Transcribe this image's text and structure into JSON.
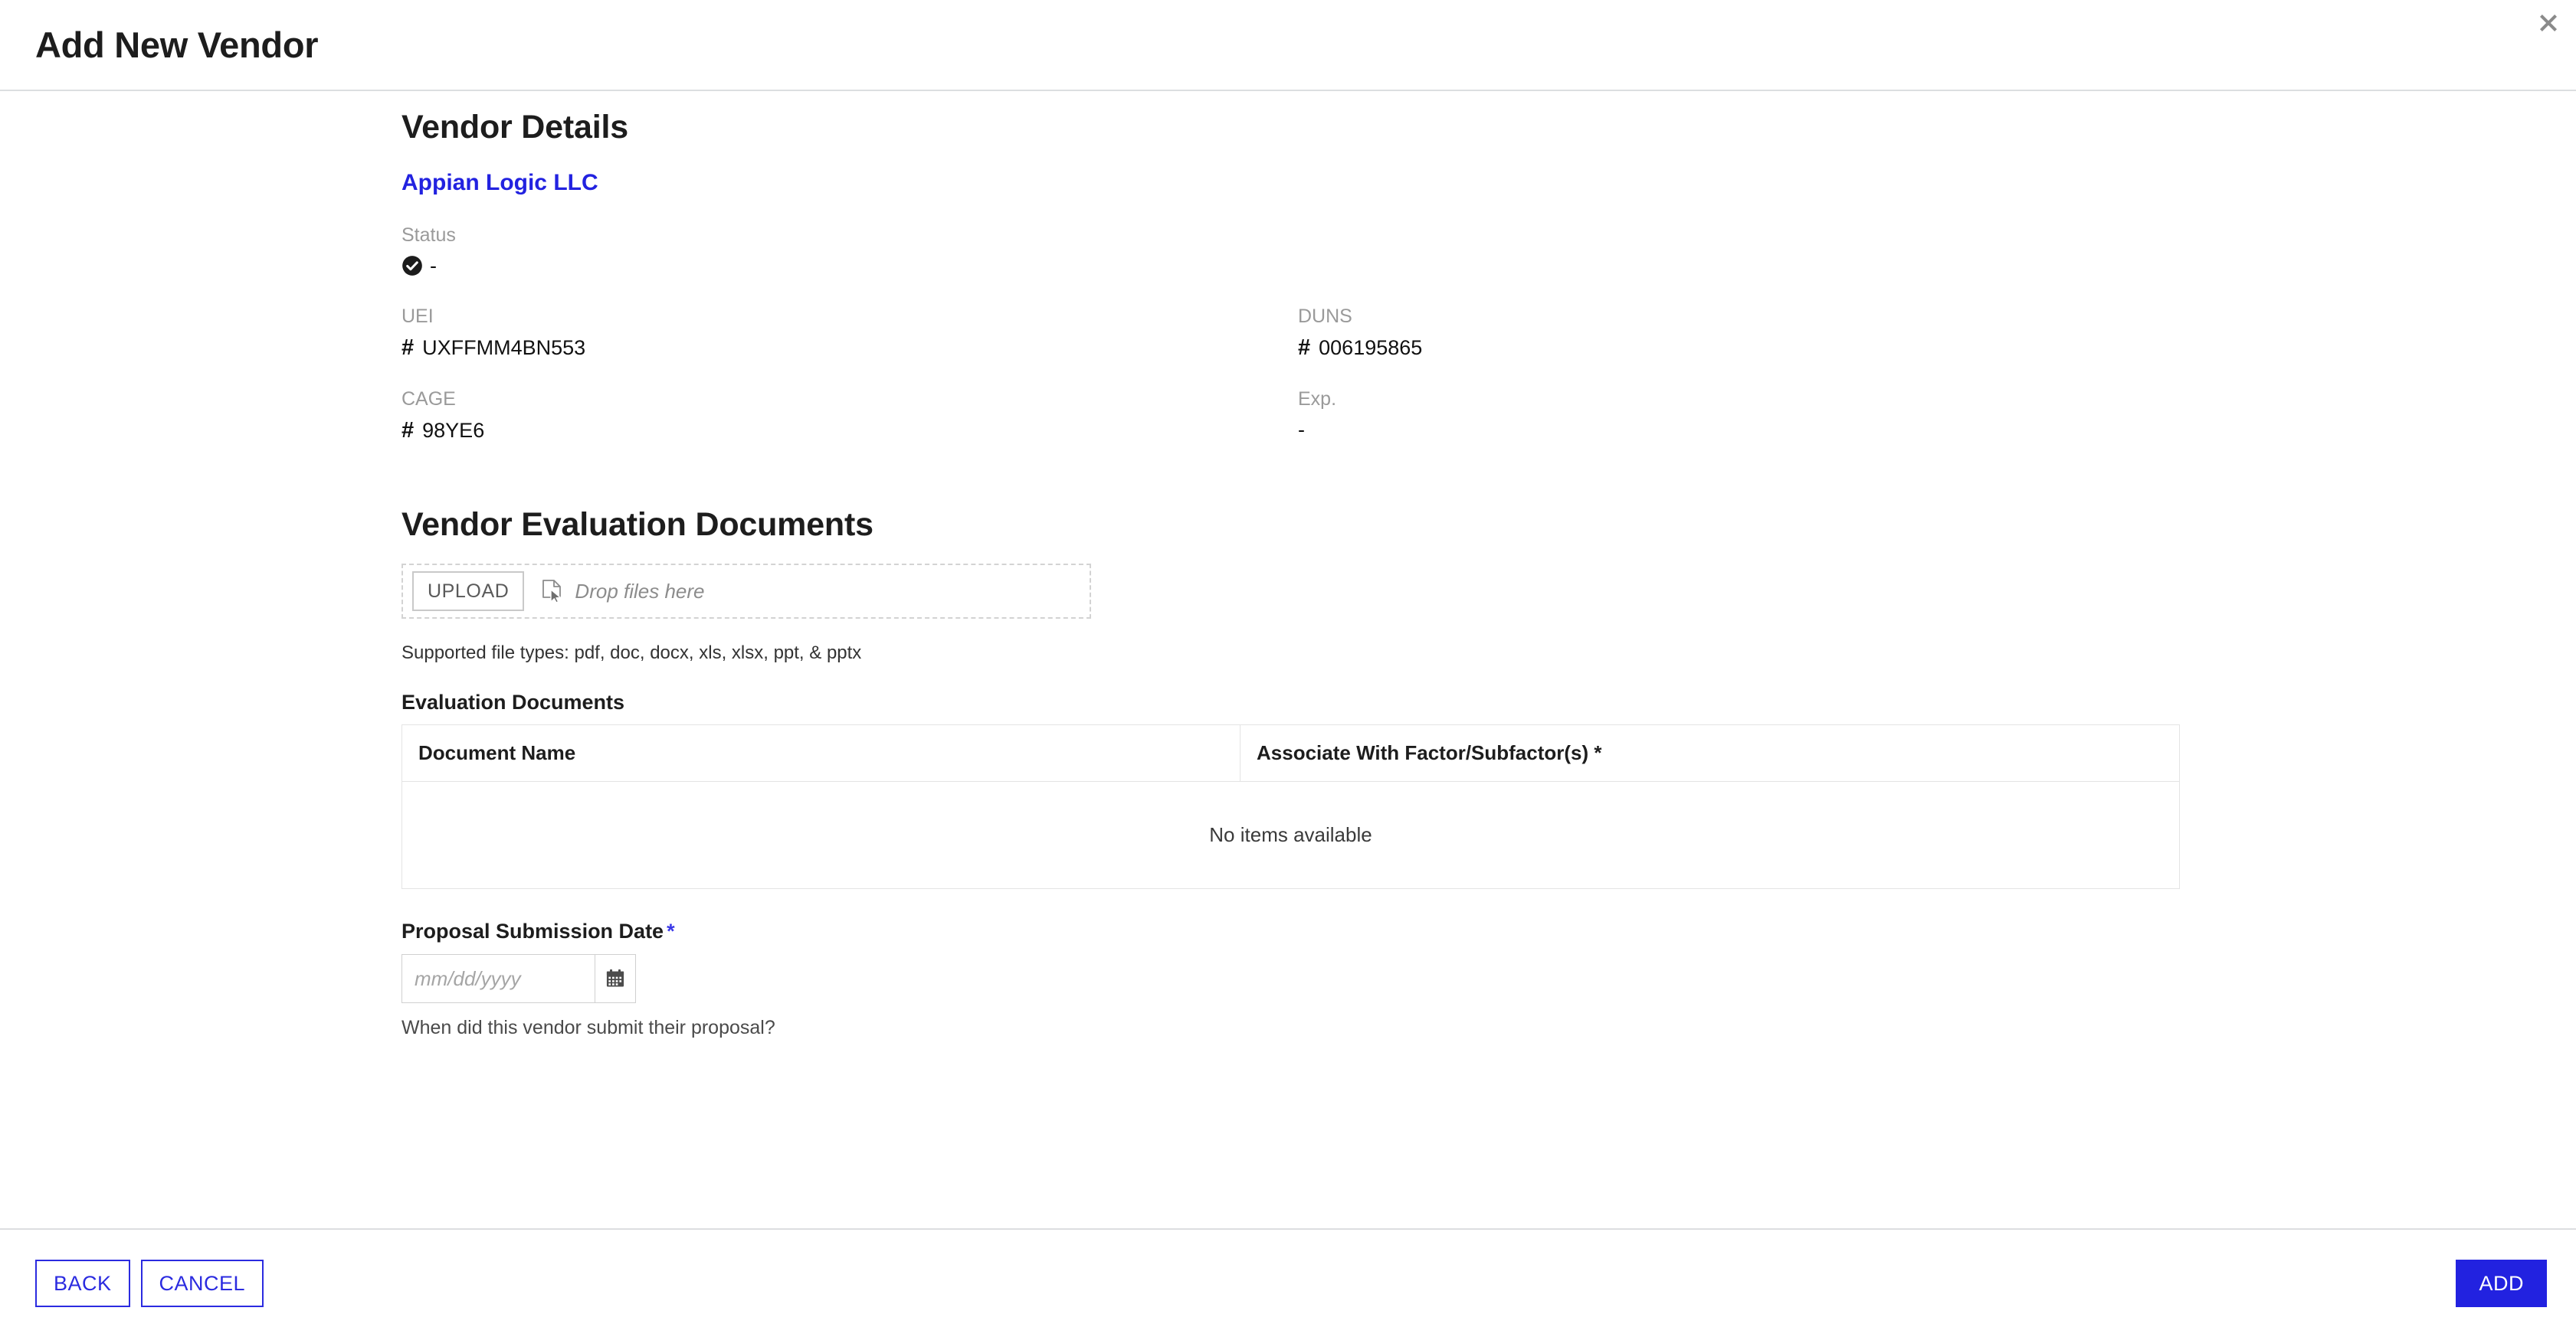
{
  "header": {
    "title": "Add New Vendor",
    "close_icon": "close-icon"
  },
  "vendor_details": {
    "section_title": "Vendor Details",
    "vendor_name": "Appian Logic LLC",
    "status": {
      "label": "Status",
      "icon": "check-circle-icon",
      "value": "-"
    },
    "fields": {
      "uei": {
        "label": "UEI",
        "prefix": "#",
        "value": "UXFFMM4BN553"
      },
      "duns": {
        "label": "DUNS",
        "prefix": "#",
        "value": "006195865"
      },
      "cage": {
        "label": "CAGE",
        "prefix": "#",
        "value": "98YE6"
      },
      "exp": {
        "label": "Exp.",
        "value": "-"
      }
    }
  },
  "evaluation_documents": {
    "section_title": "Vendor Evaluation Documents",
    "upload": {
      "button_label": "UPLOAD",
      "drop_text": "Drop files here",
      "icon": "file-cursor-icon"
    },
    "supported_types": "Supported file types: pdf, doc, docx, xls, xlsx, ppt, & pptx",
    "table_title": "Evaluation Documents",
    "table": {
      "columns": [
        "Document Name",
        "Associate With Factor/Subfactor(s) *"
      ],
      "rows": [],
      "empty_message": "No items available"
    }
  },
  "proposal_date": {
    "label": "Proposal Submission Date",
    "required_marker": "*",
    "placeholder": "mm/dd/yyyy",
    "value": "",
    "calendar_icon": "calendar-icon",
    "hint": "When did this vendor submit their proposal?"
  },
  "footer": {
    "back_label": "BACK",
    "cancel_label": "CANCEL",
    "add_label": "ADD"
  },
  "colors": {
    "accent_blue": "#2222e0",
    "border_gray": "#dcdee0",
    "muted_text": "#9a9a9a"
  }
}
